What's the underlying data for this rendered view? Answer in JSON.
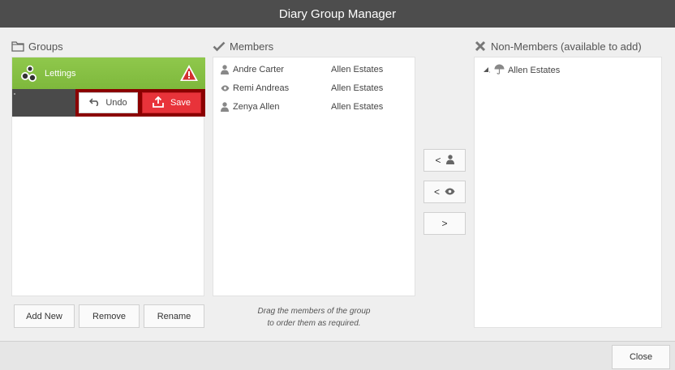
{
  "window": {
    "title": "Diary Group Manager"
  },
  "groups": {
    "title": "Groups",
    "items": [
      {
        "label": "Lettings",
        "status": "warning"
      }
    ],
    "undo_label": "Undo",
    "save_label": "Save",
    "add_new_label": "Add New",
    "remove_label": "Remove",
    "rename_label": "Rename"
  },
  "members": {
    "title": "Members",
    "rows": [
      {
        "name": "Andre Carter",
        "org": "Allen Estates",
        "icon": "person-icon"
      },
      {
        "name": "Remi Andreas",
        "org": "Allen Estates",
        "icon": "eye-icon"
      },
      {
        "name": "Zenya Allen",
        "org": "Allen Estates",
        "icon": "person-icon"
      }
    ],
    "hint_line1": "Drag the members of the group",
    "hint_line2": "to order them as required."
  },
  "transfer": {
    "add_member_label": "<",
    "add_viewer_label": "<",
    "remove_label": ">"
  },
  "non_members": {
    "title": "Non-Members (available to add)",
    "tree": [
      {
        "label": "Allen Estates",
        "icon": "umbrella-icon"
      }
    ]
  },
  "footer": {
    "close_label": "Close"
  },
  "colors": {
    "titlebar": "#4d4d4d",
    "group_selected": "#8bc34a",
    "save": "#e8333a",
    "edit_frame": "#8b0000"
  }
}
